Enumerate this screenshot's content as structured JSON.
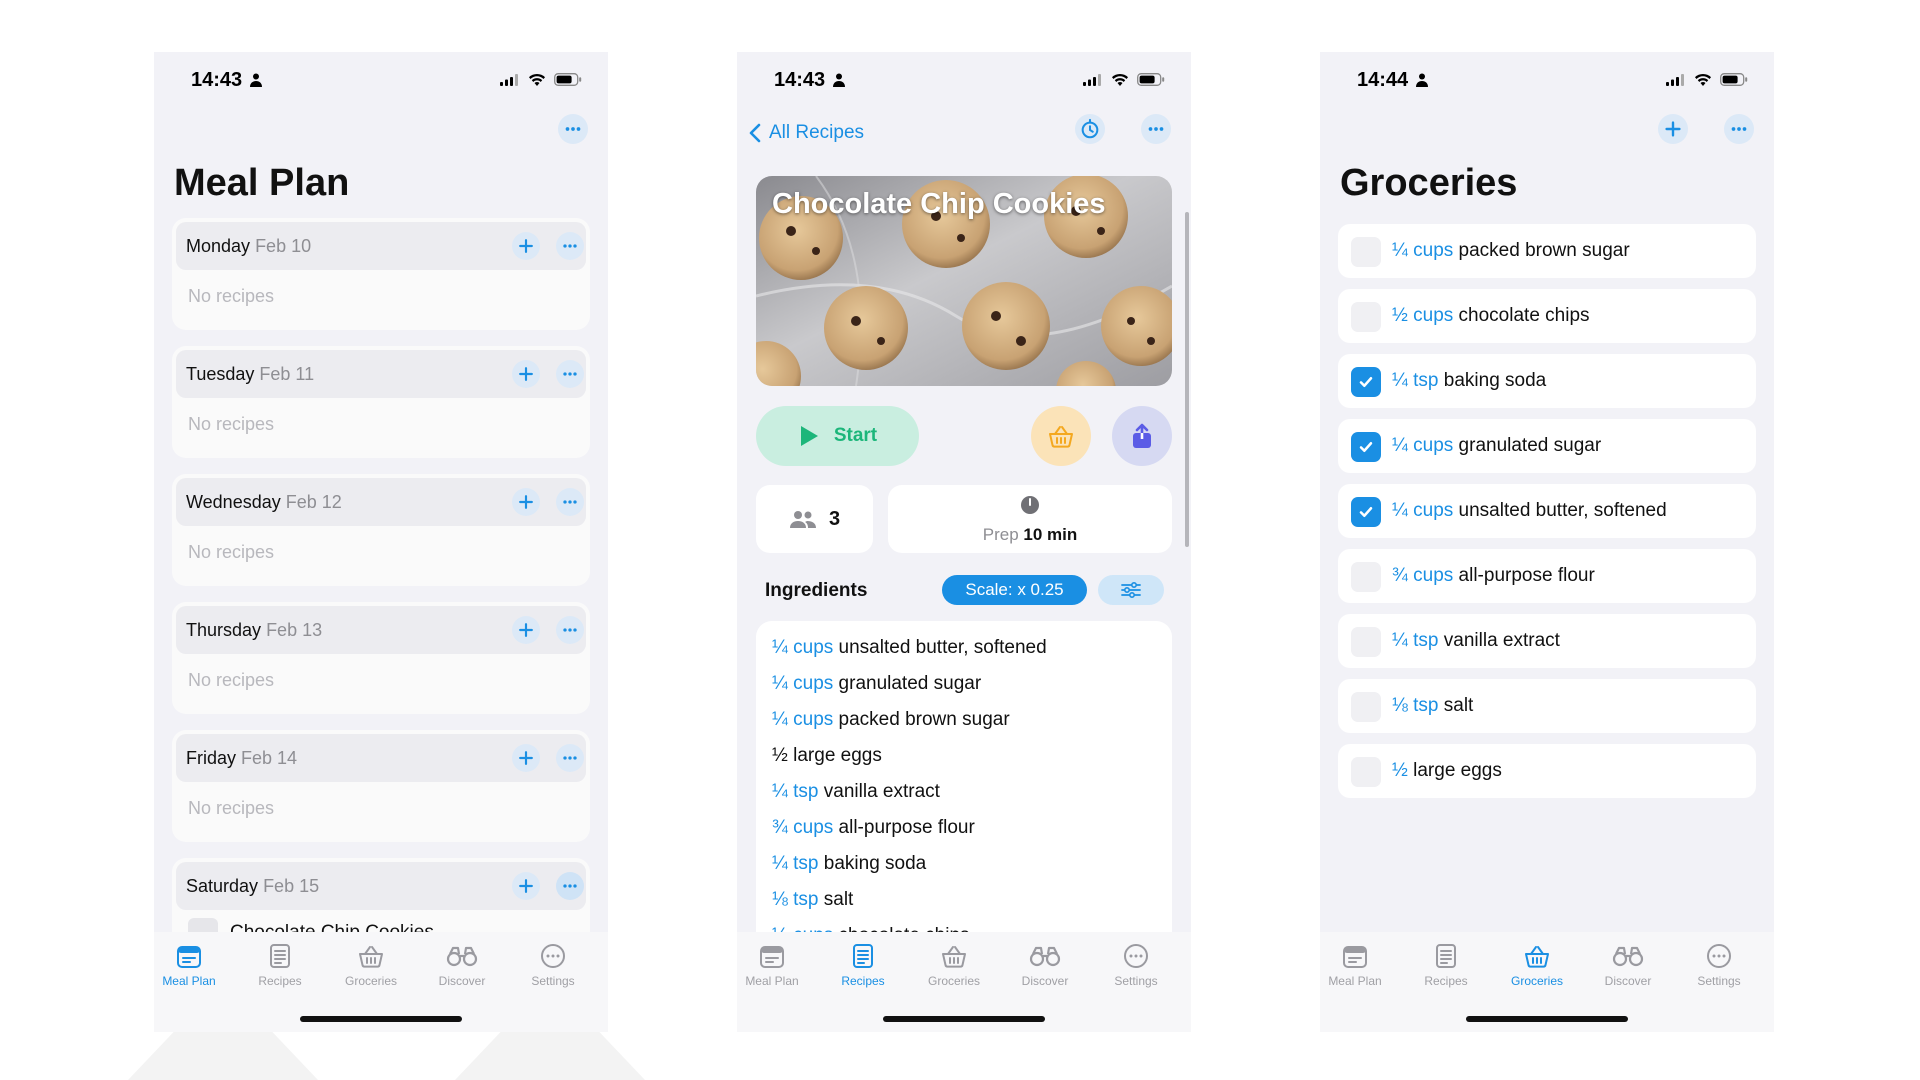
{
  "colors": {
    "accent": "#1a8fe3",
    "start_green": "#1cb67a",
    "basket_orange": "#f4a81f",
    "share_purple": "#5b5ce6"
  },
  "tabs": [
    "Meal Plan",
    "Recipes",
    "Groceries",
    "Discover",
    "Settings"
  ],
  "mealplan": {
    "time": "14:43",
    "title": "Meal Plan",
    "empty_label": "No recipes",
    "days": [
      {
        "name": "Monday",
        "date": "Feb 10"
      },
      {
        "name": "Tuesday",
        "date": "Feb 11"
      },
      {
        "name": "Wednesday",
        "date": "Feb 12"
      },
      {
        "name": "Thursday",
        "date": "Feb 13"
      },
      {
        "name": "Friday",
        "date": "Feb 14"
      },
      {
        "name": "Saturday",
        "date": "Feb 15"
      }
    ],
    "saturday_recipe": "Chocolate Chip Cookies",
    "active_tab": "Meal Plan"
  },
  "recipe": {
    "time": "14:43",
    "back_label": "All Recipes",
    "title": "Chocolate Chip Cookies",
    "start_label": "Start",
    "servings": "3",
    "prep_label": "Prep",
    "prep_value": "10 min",
    "ingredients_title": "Ingredients",
    "scale_label": "Scale: x 0.25",
    "ingredients": [
      {
        "qty": "¼ cups",
        "name": "unsalted butter, softened"
      },
      {
        "qty": "¼ cups",
        "name": "granulated sugar"
      },
      {
        "qty": "¼ cups",
        "name": "packed brown sugar"
      },
      {
        "qty": "½",
        "name": "large eggs"
      },
      {
        "qty": "¼ tsp",
        "name": "vanilla extract"
      },
      {
        "qty": "¾ cups",
        "name": "all-purpose flour"
      },
      {
        "qty": "¼ tsp",
        "name": "baking soda"
      },
      {
        "qty": "⅛ tsp",
        "name": "salt"
      },
      {
        "qty": "½ cups",
        "name": "chocolate chips"
      }
    ],
    "active_tab": "Recipes"
  },
  "groceries": {
    "time": "14:44",
    "title": "Groceries",
    "items": [
      {
        "qty": "¼ cups",
        "name": "packed brown sugar",
        "checked": false
      },
      {
        "qty": "½ cups",
        "name": "chocolate chips",
        "checked": false
      },
      {
        "qty": "¼ tsp",
        "name": "baking soda",
        "checked": true
      },
      {
        "qty": "¼ cups",
        "name": "granulated sugar",
        "checked": true
      },
      {
        "qty": "¼ cups",
        "name": "unsalted butter, softened",
        "checked": true
      },
      {
        "qty": "¾ cups",
        "name": "all-purpose flour",
        "checked": false
      },
      {
        "qty": "¼ tsp",
        "name": "vanilla extract",
        "checked": false
      },
      {
        "qty": "⅛ tsp",
        "name": "salt",
        "checked": false
      },
      {
        "qty": "½",
        "name": "large eggs",
        "checked": false
      }
    ],
    "active_tab": "Groceries"
  }
}
